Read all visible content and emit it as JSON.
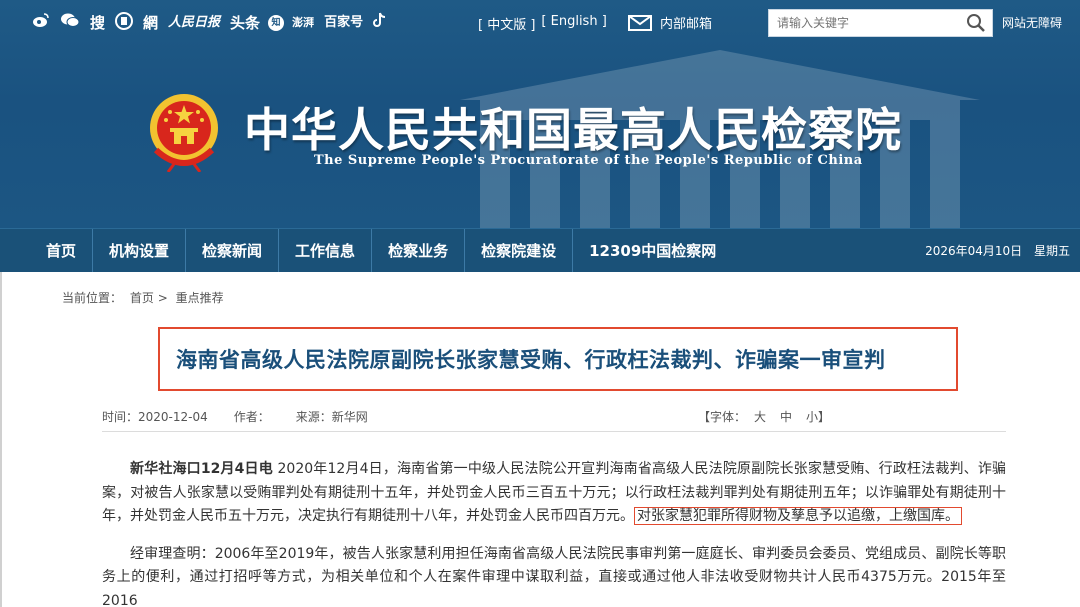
{
  "colors": {
    "header_bg": "#1c5683",
    "nav_bg": "#1a5178",
    "title_text": "#1a4f7a",
    "highlight_border": "#e24a2f"
  },
  "header": {
    "social_icons": [
      "weibo-icon",
      "wechat-icon",
      "sohu-icon",
      "app-icon",
      "netease-icon",
      "peoples-daily-icon",
      "toutiao-icon",
      "zhihu-icon",
      "pengpai-icon",
      "baijiahao-icon",
      "tiktok-icon"
    ],
    "social_labels": {
      "sohu": "搜",
      "netease": "網",
      "peoples_daily": "人民日报",
      "toutiao": "头条",
      "zhihu": "知",
      "pengpai": "澎湃",
      "baijiahao": "百家号"
    },
    "lang_cn": "[ 中文版 ]",
    "lang_en": "[ English ]",
    "mail_label": "内部邮箱",
    "search_placeholder": "请输入关键字",
    "accessibility": "网站无障碍",
    "site_title_cn": "中华人民共和国最高人民检察院",
    "site_title_en": "The Supreme People's Procuratorate of the People's Republic of China"
  },
  "nav": {
    "items": [
      "首页",
      "机构设置",
      "检察新闻",
      "工作信息",
      "检察业务",
      "检察院建设",
      "12309中国检察网"
    ],
    "date": "2026年04月10日",
    "weekday": "星期五"
  },
  "breadcrumb": {
    "label": "当前位置：",
    "home": "首页",
    "sep": ">",
    "current": "重点推荐"
  },
  "article": {
    "title": "海南省高级人民法院原副院长张家慧受贿、行政枉法裁判、诈骗案一审宣判",
    "time": "时间：2020-12-04",
    "author": "作者：",
    "source": "来源：新华网",
    "font_label": "【字体：",
    "font_large": "大",
    "font_medium": "中",
    "font_small": "小】",
    "p1_lead": "新华社海口12月4日电",
    "p1_text": "  2020年12月4日，海南省第一中级人民法院公开宣判海南省高级人民法院原副院长张家慧受贿、行政枉法裁判、诈骗案，对被告人张家慧以受贿罪判处有期徒刑十五年，并处罚金人民币三百五十万元；以行政枉法裁判罪判处有期徒刑五年；以诈骗罪处有期徒刑十年，并处罚金人民币五十万元，决定执行有期徒刑十八年，并处罚金人民币四百万元。",
    "p1_highlight": "对张家慧犯罪所得财物及孳息予以追缴，上缴国库。",
    "p2_text": "经审理查明：2006年至2019年，被告人张家慧利用担任海南省高级人民法院民事审判第一庭庭长、审判委员会委员、党组成员、副院长等职务上的便利，通过打招呼等方式，为相关单位和个人在案件审理中谋取利益，直接或通过他人非法收受财物共计人民币4375万元。2015年至2016"
  }
}
